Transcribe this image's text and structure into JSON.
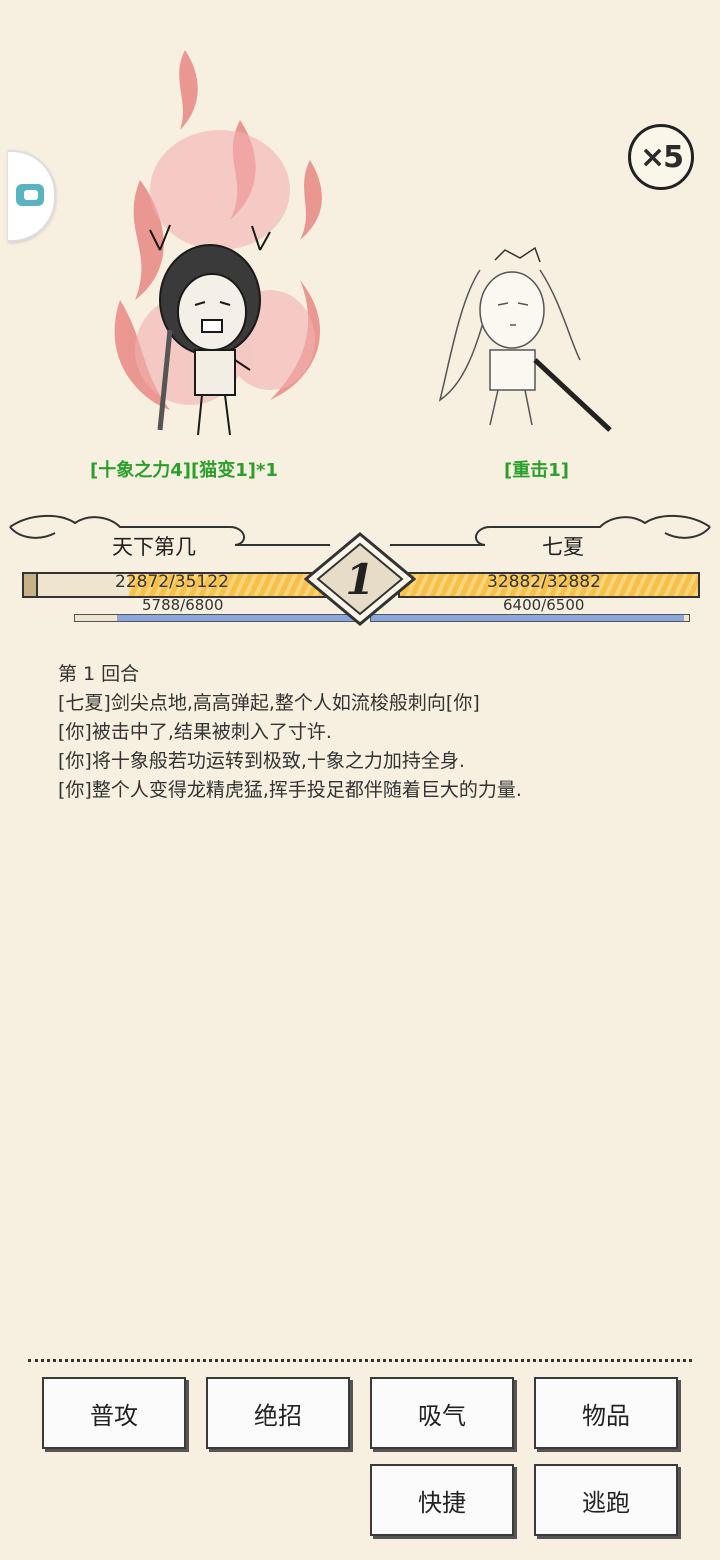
{
  "speed": {
    "label": "×5"
  },
  "player": {
    "name": "天下第几",
    "buffs": "[十象之力4][猫变1]*1",
    "hp": "22872/35122",
    "hp_fraction": 0.651,
    "mp": "5788/6800",
    "mp_fraction": 0.851
  },
  "enemy": {
    "name": "七夏",
    "buffs": "[重击1]",
    "hp": "32882/32882",
    "hp_fraction": 1.0,
    "mp": "6400/6500",
    "mp_fraction": 0.985
  },
  "round": {
    "number": "1"
  },
  "log": [
    "第 1 回合",
    "[七夏]剑尖点地,高高弹起,整个人如流梭般刺向[你]",
    "[你]被击中了,结果被刺入了寸许.",
    "[你]将十象般若功运转到极致,十象之力加持全身.",
    "[你]整个人变得龙精虎猛,挥手投足都伴随着巨大的力量."
  ],
  "actions": {
    "attack": "普攻",
    "skill": "绝招",
    "breathe": "吸气",
    "items": "物品",
    "shortcut": "快捷",
    "flee": "逃跑"
  },
  "colors": {
    "background": "#f7f0e1",
    "buff_text": "#2b9f2b",
    "hp_bar": "#f6c04a",
    "mp_bar": "#8aa6dc"
  }
}
